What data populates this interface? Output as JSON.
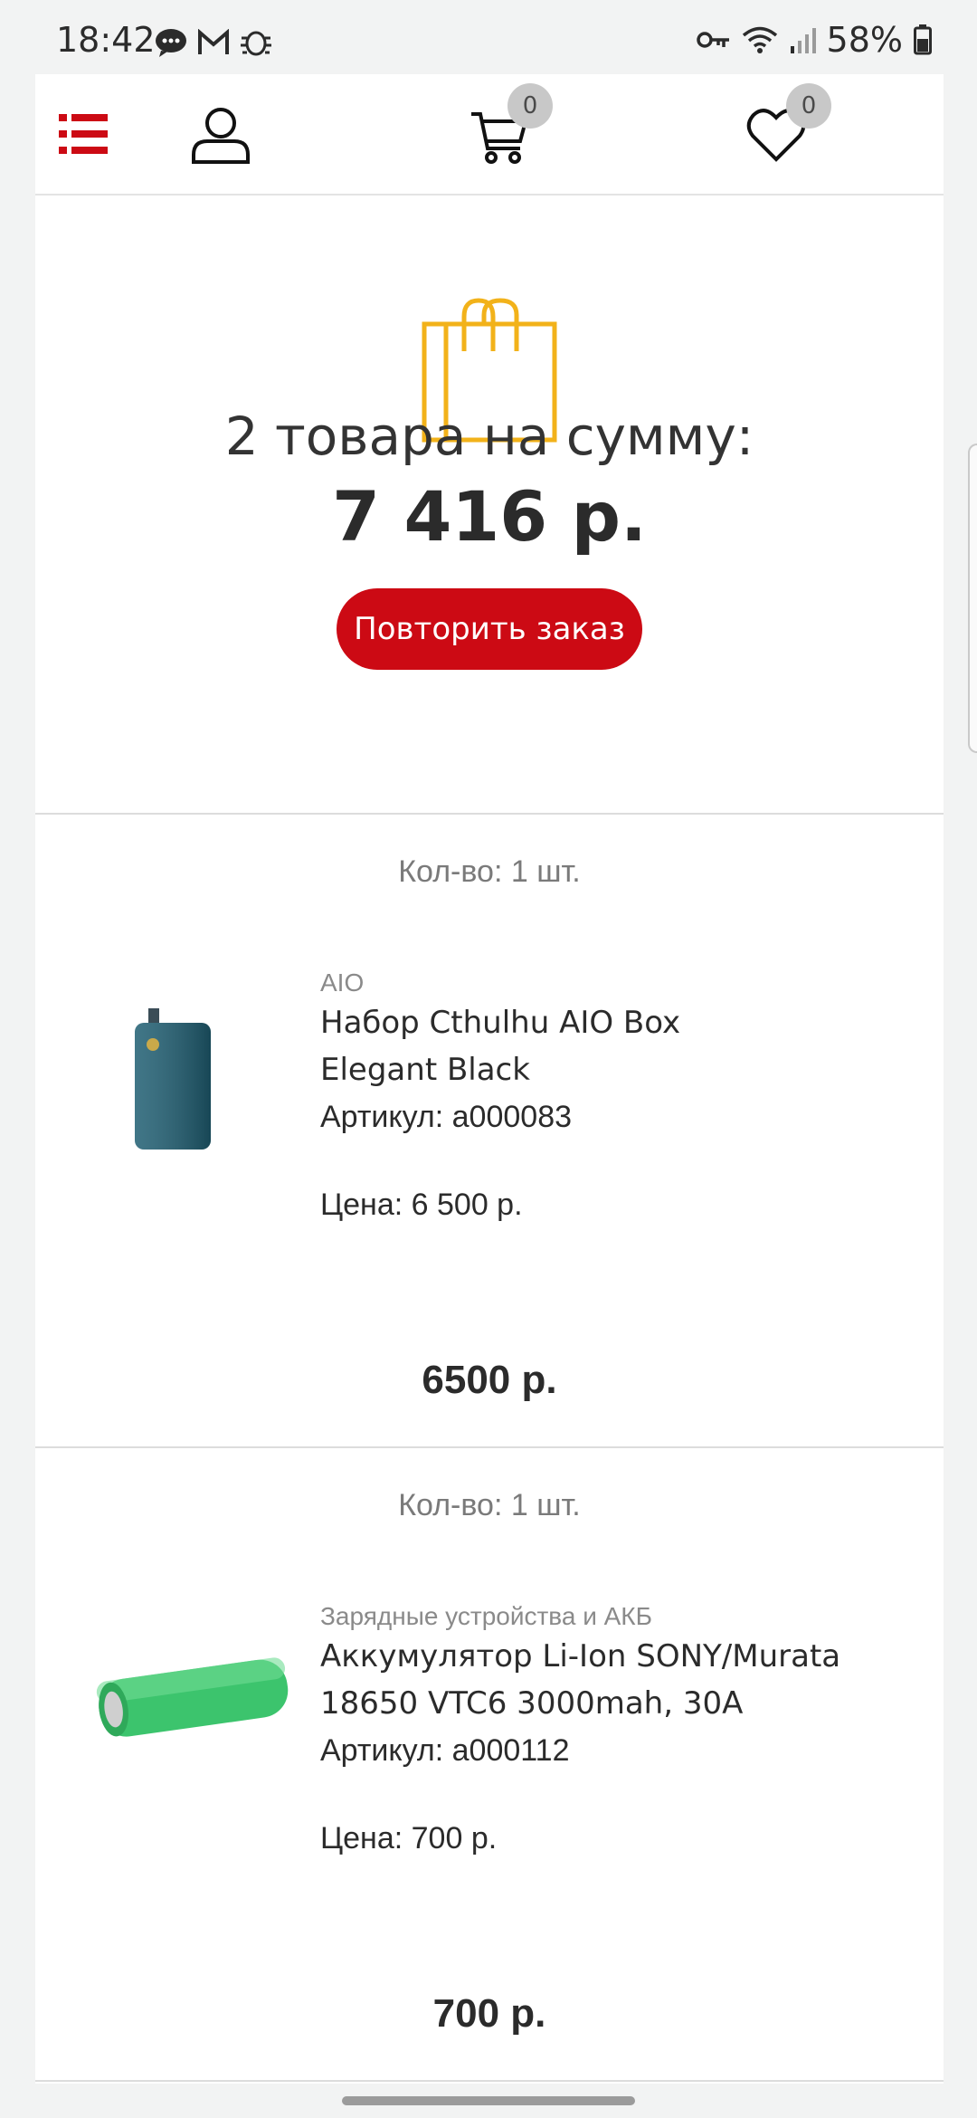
{
  "status_bar": {
    "time": "18:42",
    "battery": "58%"
  },
  "toolbar": {
    "cart_count": "0",
    "favorites_count": "0"
  },
  "summary": {
    "count_text": "2 товара на сумму:",
    "total": "7 416 р.",
    "reorder_label": "Повторить заказ"
  },
  "products": [
    {
      "qty": "Кол-во: 1 шт.",
      "category": "AIO",
      "name_line1": "Набор Cthulhu AIO Box",
      "name_line2": "Elegant Black",
      "sku": "Артикул: a000083",
      "price": "Цена: 6 500 р.",
      "line_total": "6500 р."
    },
    {
      "qty": "Кол-во: 1 шт.",
      "category": "Зарядные устройства и АКБ",
      "name_line1": "Аккумулятор Li-Ion SONY/Murata",
      "name_line2": "18650 VTC6 3000mah, 30A",
      "sku": "Артикул: a000112",
      "price": "Цена: 700 р.",
      "line_total": "700 р."
    }
  ],
  "colors": {
    "accent": "#cc0a14",
    "bag": "#f2b21a",
    "battery_green": "#3cc46d"
  },
  "icons": [
    "menu-list-icon",
    "user-icon",
    "cart-icon",
    "heart-icon",
    "shopping-bag-icon"
  ]
}
